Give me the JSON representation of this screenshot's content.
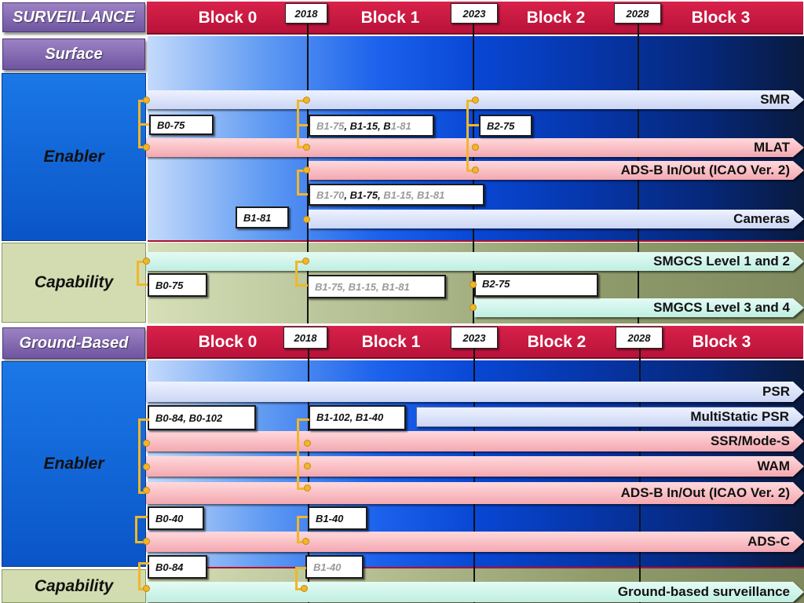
{
  "title": "SURVEILLANCE",
  "sections": {
    "surface": "Surface",
    "ground_based": "Ground-Based"
  },
  "row_labels": {
    "enabler": "Enabler",
    "capability": "Capability"
  },
  "blocks": [
    "Block 0",
    "Block 1",
    "Block 2",
    "Block 3"
  ],
  "years": [
    "2018",
    "2023",
    "2028"
  ],
  "surface_enablers": [
    {
      "label": "SMR",
      "color": "blue"
    },
    {
      "label": "MLAT",
      "color": "pink"
    },
    {
      "label": "ADS-B In/Out  (ICAO Ver. 2)",
      "color": "pink"
    },
    {
      "label": "Cameras",
      "color": "blue"
    }
  ],
  "surface_enabler_refs": {
    "b0": "B0-75",
    "b1_first": {
      "a": "B1-75",
      "sep1": ", ",
      "b": "B1-15",
      "sep2": ", B",
      "c": "1-81"
    },
    "b2": "B2-75",
    "adsb": {
      "a": "B1-70",
      "sep1": ", ",
      "b": "B1-75",
      "sep2": ", ",
      "c": "B1-15, B1-81"
    },
    "cameras": "B1-81"
  },
  "surface_capabilities": [
    {
      "label": "SMGCS Level 1 and 2",
      "color": "cyan"
    },
    {
      "label": "SMGCS Level 3 and 4",
      "color": "cyan"
    }
  ],
  "surface_capability_refs": {
    "b0": "B0-75",
    "b1": "B1-75, B1-15, B1-81",
    "b2": "B2-75"
  },
  "ground_enablers": [
    {
      "label": "PSR",
      "color": "blue"
    },
    {
      "label": "MultiStatic PSR",
      "color": "blue"
    },
    {
      "label": "SSR/Mode-S",
      "color": "pink"
    },
    {
      "label": "WAM",
      "color": "pink"
    },
    {
      "label": "ADS-B In/Out (ICAO Ver. 2)",
      "color": "pink"
    },
    {
      "label": "ADS-C",
      "color": "pink"
    }
  ],
  "ground_enabler_refs": {
    "b0": "B0-84, B0-102",
    "b1": "B1-102, B1-40",
    "b0_adsc": "B0-40",
    "b1_adsc": "B1-40"
  },
  "ground_capabilities": [
    {
      "label": "Ground-based surveillance",
      "color": "cyan"
    }
  ],
  "ground_capability_refs": {
    "b0": "B0-84",
    "b1": "B1-40"
  },
  "colors": {
    "header_red": "#c8183f",
    "bracket_yellow": "#f1b62a",
    "side_purple": "#8a70b8",
    "side_blue": "#1466d8",
    "side_green": "#d3dcb0"
  }
}
